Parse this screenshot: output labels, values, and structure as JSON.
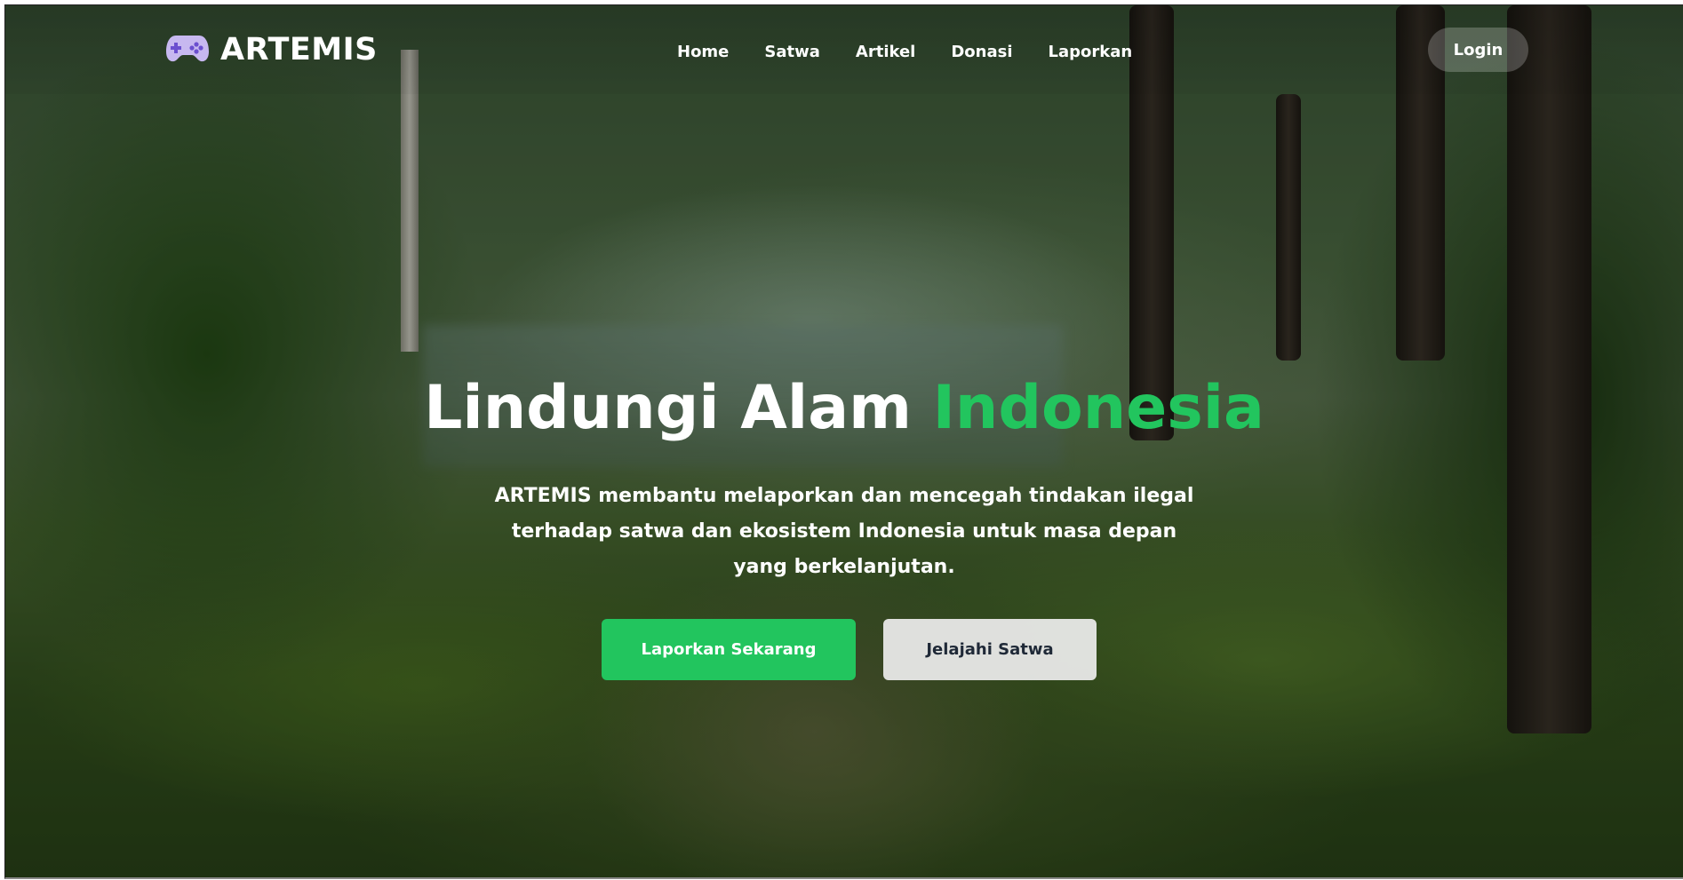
{
  "brand": {
    "name": "ARTEMIS",
    "icon": "gamepad-icon"
  },
  "nav": {
    "links": [
      "Home",
      "Satwa",
      "Artikel",
      "Donasi",
      "Laporkan"
    ],
    "login_label": "Login"
  },
  "hero": {
    "title_main": "Lindungi Alam ",
    "title_accent": "Indonesia",
    "description": "ARTEMIS membantu melaporkan dan mencegah tindakan ilegal terhadap satwa dan ekosistem Indonesia untuk masa depan yang berkelanjutan.",
    "primary_button": "Laporkan Sekarang",
    "secondary_button": "Jelajahi Satwa"
  },
  "colors": {
    "accent": "#22c55e",
    "text": "#ffffff"
  }
}
